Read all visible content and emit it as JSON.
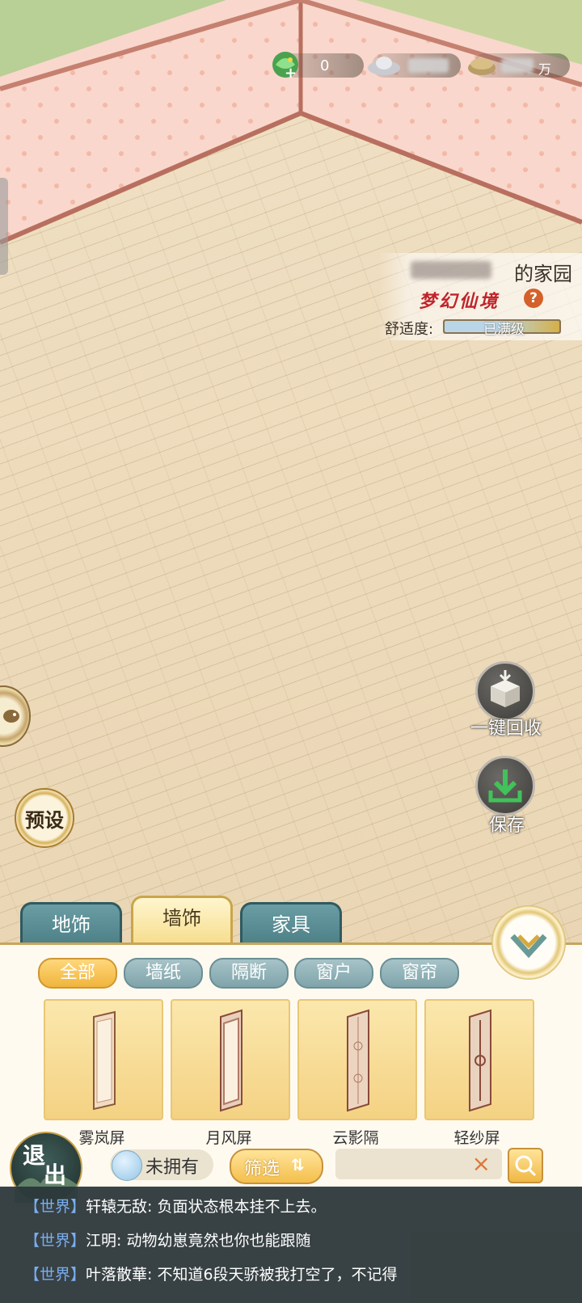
{
  "currency": {
    "jade": "0",
    "silver": "",
    "coins_suffix": "万"
  },
  "home": {
    "owner_suffix": "的家园",
    "level": "梦幻仙境",
    "help": "?",
    "comfort_label": "舒适度:",
    "comfort_text": "已满级",
    "comfort_fraction": 1.0
  },
  "side_buttons": {
    "recycle_label": "一键回收",
    "save_label": "保存",
    "preset_label": "预设"
  },
  "category_tabs": [
    {
      "label": "地饰",
      "active": false
    },
    {
      "label": "墙饰",
      "active": true
    },
    {
      "label": "家具",
      "active": false
    }
  ],
  "sub_tabs": [
    {
      "label": "全部",
      "active": true
    },
    {
      "label": "墙纸",
      "active": false
    },
    {
      "label": "隔断",
      "active": false
    },
    {
      "label": "窗户",
      "active": false
    },
    {
      "label": "窗帘",
      "active": false
    }
  ],
  "items": [
    {
      "name": "雾岚屏"
    },
    {
      "name": "月风屏"
    },
    {
      "name": "云影隔"
    },
    {
      "name": "轻纱屏"
    }
  ],
  "controls": {
    "owned_label": "未拥有",
    "filter_label": "筛选",
    "filter_icon": "⇅",
    "clear_icon": "×",
    "exit_label_1": "退",
    "exit_label_2": "出"
  },
  "chat": [
    {
      "channel": "【世界】",
      "name": "轩辕无敌",
      "text": ": 负面状态根本挂不上去。"
    },
    {
      "channel": "【世界】",
      "name": "江明",
      "text": ": 动物幼崽竟然也你也能跟随"
    },
    {
      "channel": "【世界】",
      "name": "叶落散華",
      "text": ": 不知道6段天骄被我打空了，不记得"
    }
  ]
}
